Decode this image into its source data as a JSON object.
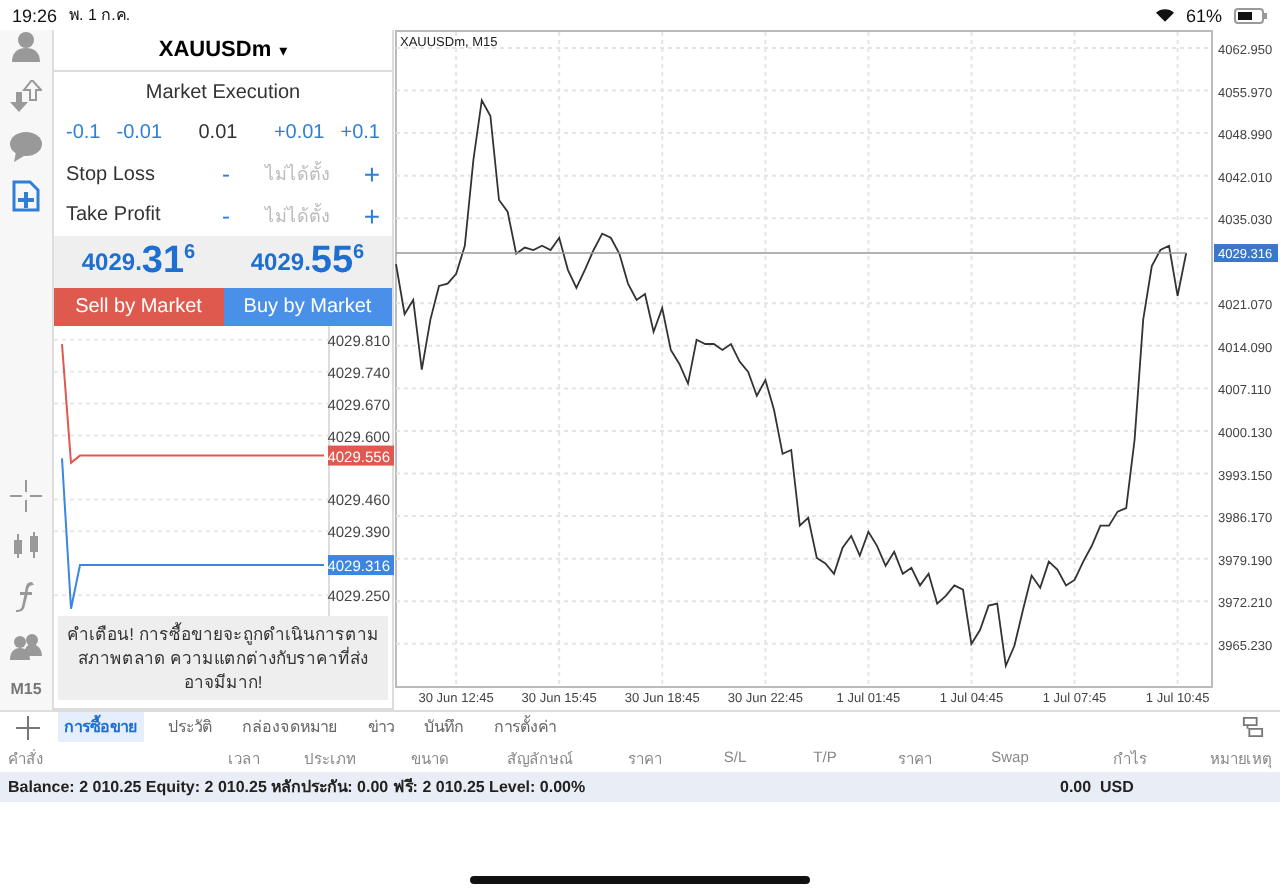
{
  "status_bar": {
    "time": "19:26",
    "date": "พ. 1 ก.ค.",
    "battery": "61%"
  },
  "sidebar": {
    "timeframe": "M15"
  },
  "order_panel": {
    "symbol": "XAUUSDm",
    "caret": "▾",
    "execution": "Market Execution",
    "volume": {
      "decrements": [
        "-0.1",
        "-0.01"
      ],
      "value": "0.01",
      "increments": [
        "+0.01",
        "+0.1"
      ]
    },
    "stops": [
      {
        "label": "Stop Loss",
        "minus": "-",
        "placeholder": "ไม่ได้ตั้ง",
        "plus": "+"
      },
      {
        "label": "Take Profit",
        "minus": "-",
        "placeholder": "ไม่ได้ตั้ง",
        "plus": "+"
      }
    ],
    "prices": [
      {
        "small": "4029.",
        "big": "31",
        "sup": "6"
      },
      {
        "small": "4029.",
        "big": "55",
        "sup": "6"
      }
    ],
    "buttons": [
      {
        "label": "Sell by Market",
        "kind": "sell"
      },
      {
        "label": "Buy by Market",
        "kind": "buy"
      }
    ],
    "chart_data": {
      "type": "line",
      "categories": [
        null,
        null,
        null,
        null,
        null,
        null,
        null,
        null,
        null,
        null,
        null,
        null,
        null,
        null,
        null,
        null,
        null,
        null,
        null,
        null,
        null,
        null,
        null,
        null,
        null,
        null,
        null,
        null,
        null,
        null
      ],
      "series": [
        {
          "color": "#e0584f",
          "values": [
            4029.8,
            4029.54,
            4029.556,
            4029.556,
            4029.556,
            4029.556,
            4029.556,
            4029.556,
            4029.556,
            4029.556,
            4029.556,
            4029.556,
            4029.556,
            4029.556,
            4029.556,
            4029.556,
            4029.556,
            4029.556,
            4029.556,
            4029.556,
            4029.556,
            4029.556,
            4029.556,
            4029.556,
            4029.556,
            4029.556,
            4029.556,
            4029.556,
            4029.556,
            4029.556
          ]
        },
        {
          "color": "#3b86e0",
          "values": [
            4029.55,
            4029.22,
            4029.316,
            4029.316,
            4029.316,
            4029.316,
            4029.316,
            4029.316,
            4029.316,
            4029.316,
            4029.316,
            4029.316,
            4029.316,
            4029.316,
            4029.316,
            4029.316,
            4029.316,
            4029.316,
            4029.316,
            4029.316,
            4029.316,
            4029.316,
            4029.316,
            4029.316,
            4029.316,
            4029.316,
            4029.316,
            4029.316,
            4029.316,
            4029.316
          ]
        }
      ],
      "grid": true,
      "ylim": [
        4029.2,
        4029.84
      ],
      "yticks": [
        {
          "value": 4029.81,
          "label": "4029.810"
        },
        {
          "value": 4029.74,
          "label": "4029.740"
        },
        {
          "value": 4029.67,
          "label": "4029.670"
        },
        {
          "value": 4029.6,
          "label": "4029.600"
        },
        {
          "value": 4029.46,
          "label": "4029.460"
        },
        {
          "value": 4029.39,
          "label": "4029.390"
        },
        {
          "value": 4029.25,
          "label": "4029.250"
        }
      ],
      "annotations": [
        {
          "y": 4029.556,
          "text": "4029.556"
        },
        {
          "y": 4029.316,
          "text": "4029.316"
        }
      ]
    },
    "warning": "คำเตือน! การซื้อขายจะถูกดำเนินการตามสภาพตลาด ความแตกต่างกับราคาที่ส่งอาจมีมาก!"
  },
  "chart": {
    "title": "XAUUSDm, M15",
    "chart_data": {
      "type": "line",
      "categories": [
        null,
        null,
        null,
        null,
        null,
        null,
        null,
        "30 Jun 12:45",
        null,
        null,
        null,
        null,
        null,
        null,
        null,
        null,
        null,
        null,
        null,
        "30 Jun 15:45",
        null,
        null,
        null,
        null,
        null,
        null,
        null,
        null,
        null,
        null,
        null,
        "30 Jun 18:45",
        null,
        null,
        null,
        null,
        null,
        null,
        null,
        null,
        null,
        null,
        null,
        "30 Jun 22:45",
        null,
        null,
        null,
        null,
        null,
        null,
        null,
        null,
        null,
        null,
        null,
        "1 Jul 01:45",
        null,
        null,
        null,
        null,
        null,
        null,
        null,
        null,
        null,
        null,
        null,
        "1 Jul 04:45",
        null,
        null,
        null,
        null,
        null,
        null,
        null,
        null,
        null,
        null,
        null,
        "1 Jul 07:45",
        null,
        null,
        null,
        null,
        null,
        null,
        null,
        null,
        null,
        null,
        null,
        "1 Jul 10:45",
        null
      ],
      "series": [
        {
          "color": "#333333",
          "values": [
            4027.5,
            4019.3,
            4021.6,
            4010.2,
            4018.4,
            4023.9,
            4024.3,
            4025.9,
            4030.5,
            4044.6,
            4054.4,
            4051.8,
            4038.0,
            4036.1,
            4029.2,
            4030.2,
            4029.8,
            4030.5,
            4029.8,
            4031.8,
            4026.6,
            4023.6,
            4026.6,
            4029.8,
            4032.5,
            4031.8,
            4029.2,
            4024.3,
            4021.6,
            4022.6,
            4016.4,
            4020.3,
            4013.4,
            4011.1,
            4007.9,
            4015.1,
            4014.4,
            4014.4,
            4013.4,
            4014.4,
            4011.5,
            4009.8,
            4005.9,
            4008.5,
            4003.6,
            3996.4,
            3997.0,
            3984.6,
            3985.9,
            3979.3,
            3978.4,
            3976.7,
            3981.0,
            3982.9,
            3979.7,
            3983.6,
            3981.3,
            3978.0,
            3980.3,
            3976.7,
            3977.7,
            3974.8,
            3976.7,
            3971.8,
            3973.1,
            3974.8,
            3974.1,
            3965.2,
            3967.5,
            3971.5,
            3971.8,
            3961.6,
            3964.9,
            3970.8,
            3976.4,
            3974.4,
            3978.7,
            3977.4,
            3974.8,
            3975.7,
            3978.7,
            3981.3,
            3984.6,
            3984.6,
            3986.9,
            3987.5,
            3998.7,
            4018.4,
            4027.2,
            4029.8,
            4030.5,
            4022.3,
            4029.316
          ]
        },
        {
          "color": "#999999",
          "values": [
            4029.316,
            4029.316,
            4029.316,
            4029.316,
            4029.316,
            4029.316,
            4029.316,
            4029.316,
            4029.316,
            4029.316,
            4029.316,
            4029.316,
            4029.316,
            4029.316,
            4029.316,
            4029.316,
            4029.316,
            4029.316,
            4029.316,
            4029.316,
            4029.316,
            4029.316,
            4029.316,
            4029.316,
            4029.316,
            4029.316,
            4029.316,
            4029.316,
            4029.316,
            4029.316,
            4029.316,
            4029.316,
            4029.316,
            4029.316,
            4029.316,
            4029.316,
            4029.316,
            4029.316,
            4029.316,
            4029.316,
            4029.316,
            4029.316,
            4029.316,
            4029.316,
            4029.316,
            4029.316,
            4029.316,
            4029.316,
            4029.316,
            4029.316,
            4029.316,
            4029.316,
            4029.316,
            4029.316,
            4029.316,
            4029.316,
            4029.316,
            4029.316,
            4029.316,
            4029.316,
            4029.316,
            4029.316,
            4029.316,
            4029.316,
            4029.316,
            4029.316,
            4029.316,
            4029.316,
            4029.316,
            4029.316,
            4029.316,
            4029.316,
            4029.316,
            4029.316,
            4029.316,
            4029.316,
            4029.316,
            4029.316,
            4029.316,
            4029.316,
            4029.316,
            4029.316,
            4029.316,
            4029.316,
            4029.316,
            4029.316,
            4029.316,
            4029.316,
            4029.316,
            4029.316,
            4029.316,
            4029.316,
            4029.316
          ]
        }
      ],
      "ylim": [
        3958.3,
        4065.9
      ],
      "grid": true,
      "yticks": [
        {
          "value": 4062.95,
          "label": "4062.950"
        },
        {
          "value": 4055.97,
          "label": "4055.970"
        },
        {
          "value": 4048.99,
          "label": "4048.990"
        },
        {
          "value": 4042.01,
          "label": "4042.010"
        },
        {
          "value": 4035.03,
          "label": "4035.030"
        },
        {
          "value": 4021.07,
          "label": "4021.070"
        },
        {
          "value": 4014.09,
          "label": "4014.090"
        },
        {
          "value": 4007.11,
          "label": "4007.110"
        },
        {
          "value": 4000.13,
          "label": "4000.130"
        },
        {
          "value": 3993.15,
          "label": "3993.150"
        },
        {
          "value": 3986.17,
          "label": "3986.170"
        },
        {
          "value": 3979.19,
          "label": "3979.190"
        },
        {
          "value": 3972.21,
          "label": "3972.210"
        },
        {
          "value": 3965.23,
          "label": "3965.230"
        }
      ],
      "annotations": [
        "4029.316"
      ]
    }
  },
  "tabs": [
    {
      "label": "การซื้อขาย",
      "selected": true
    },
    {
      "label": "ประวัติ",
      "selected": false
    },
    {
      "label": "กล่องจดหมาย",
      "selected": false
    },
    {
      "label": "ข่าว",
      "selected": false
    },
    {
      "label": "บันทึก",
      "selected": false
    },
    {
      "label": "การตั้งค่า",
      "selected": false
    }
  ],
  "table": {
    "columns": [
      "คำสั่ง",
      "เวลา",
      "ประเภท",
      "ขนาด",
      "สัญลักษณ์",
      "ราคา",
      "S/L",
      "T/P",
      "ราคา",
      "Swap",
      "กำไร",
      "หมายเหตุ"
    ],
    "balance_row": {
      "summary": "Balance: 2 010.25 Equity: 2 010.25 หลักประกัน: 0.00 ฟรี: 2 010.25 Level: 0.00%",
      "profit": "0.00",
      "currency": "USD"
    }
  }
}
